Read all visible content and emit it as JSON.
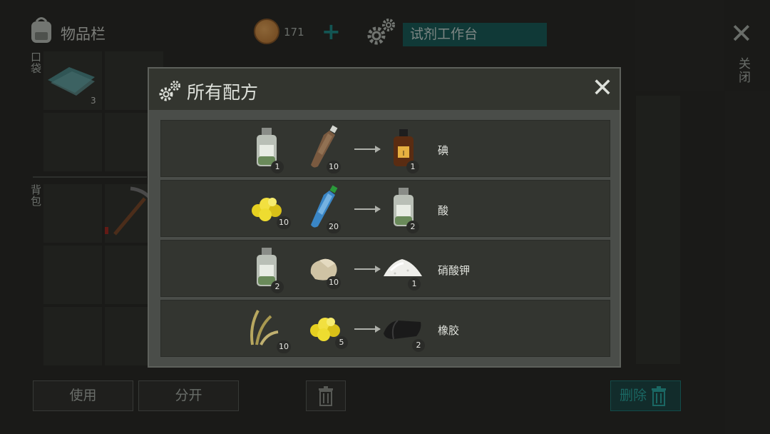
{
  "inventory": {
    "title": "物品栏",
    "pocket_label": "口袋",
    "backpack_label": "背包",
    "slot_count": "3"
  },
  "currency": {
    "coin_count": "171",
    "plus_label": "+"
  },
  "station": {
    "name": "试剂工作台"
  },
  "window": {
    "close_label": "关闭",
    "close_symbol": "✕"
  },
  "buttons": {
    "use": "使用",
    "split": "分开",
    "delete": "删除"
  },
  "modal": {
    "title": "所有配方",
    "close_symbol": "✕",
    "recipes": [
      {
        "inputs": [
          {
            "icon": "reagent-bottle-icon",
            "count": "1"
          },
          {
            "icon": "dirty-water-bottle-icon",
            "count": "10"
          }
        ],
        "output": {
          "icon": "iodine-bottle-icon",
          "count": "1",
          "name": "碘"
        }
      },
      {
        "inputs": [
          {
            "icon": "sulfur-icon",
            "count": "10"
          },
          {
            "icon": "water-bottle-icon",
            "count": "20"
          }
        ],
        "output": {
          "icon": "reagent-bottle-icon",
          "count": "2",
          "name": "酸"
        }
      },
      {
        "inputs": [
          {
            "icon": "reagent-bottle-icon",
            "count": "2"
          },
          {
            "icon": "stone-icon",
            "count": "10"
          }
        ],
        "output": {
          "icon": "salt-pile-icon",
          "count": "1",
          "name": "硝酸钾"
        }
      },
      {
        "inputs": [
          {
            "icon": "grass-icon",
            "count": "10"
          },
          {
            "icon": "sulfur-icon",
            "count": "5"
          }
        ],
        "output": {
          "icon": "rubber-icon",
          "count": "2",
          "name": "橡胶"
        }
      }
    ]
  }
}
